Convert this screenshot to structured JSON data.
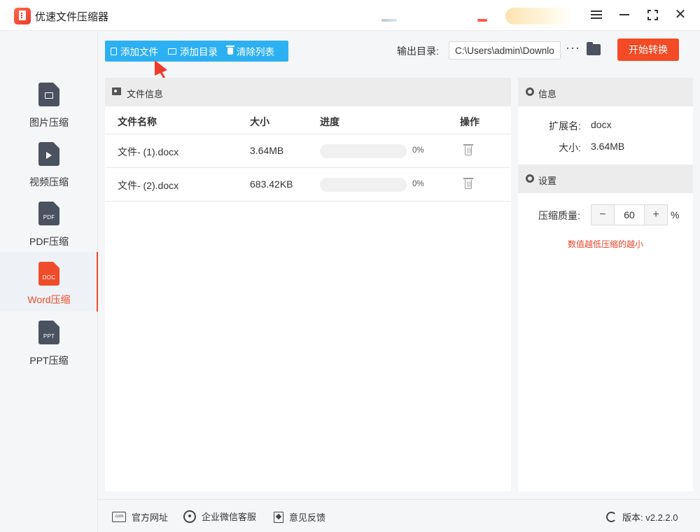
{
  "app": {
    "title": "优速文件压缩器"
  },
  "sidebar": {
    "items": [
      {
        "label": "图片压缩",
        "icon": "image-file-icon"
      },
      {
        "label": "视频压缩",
        "icon": "video-file-icon"
      },
      {
        "label": "PDF压缩",
        "icon": "pdf-file-icon",
        "tag": "PDF"
      },
      {
        "label": "Word压缩",
        "icon": "doc-file-icon",
        "tag": "DOC",
        "active": true
      },
      {
        "label": "PPT压缩",
        "icon": "ppt-file-icon",
        "tag": "PPT"
      }
    ]
  },
  "toolbar": {
    "add_file": "添加文件",
    "add_folder": "添加目录",
    "clear_list": "清除列表",
    "output_label": "输出目录:",
    "output_path": "C:\\Users\\admin\\Downlo",
    "more": "···",
    "start": "开始转换"
  },
  "file_panel": {
    "title": "文件信息",
    "columns": [
      "文件名称",
      "大小",
      "进度",
      "操作"
    ],
    "rows": [
      {
        "name": "文件- (1).docx",
        "size": "3.64MB",
        "progress": "0%"
      },
      {
        "name": "文件- (2).docx",
        "size": "683.42KB",
        "progress": "0%"
      }
    ]
  },
  "info_panel": {
    "title": "信息",
    "ext_label": "扩展名:",
    "ext_value": "docx",
    "size_label": "大小:",
    "size_value": "3.64MB"
  },
  "settings_panel": {
    "title": "设置",
    "quality_label": "压缩质量:",
    "quality_value": "60",
    "minus": "−",
    "plus": "+",
    "unit": "%",
    "hint": "数值越低压缩的越小"
  },
  "footer": {
    "website": "官方网址",
    "wechat": "企业微信客服",
    "feedback": "意见反馈",
    "version": "版本: v2.2.2.0",
    "web_icon_text": ".com"
  },
  "colors": {
    "accent": "#f24b25",
    "toolbar_blue": "#2db0f2",
    "hint_red": "#e8452c"
  }
}
